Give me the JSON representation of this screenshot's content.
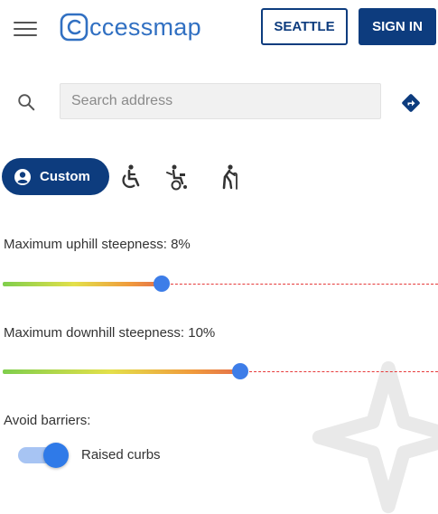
{
  "header": {
    "logo_text": "ccessmap",
    "logo_color": "#3170c2",
    "region_button": "SEATTLE",
    "signin_button": "SIGN IN",
    "brand_dark": "#0d3c7e"
  },
  "search": {
    "placeholder": "Search address",
    "value": ""
  },
  "profiles": {
    "items": [
      {
        "label": "Custom",
        "icon": "user-circle-icon",
        "selected": true
      },
      {
        "icon": "wheelchair-icon",
        "selected": false
      },
      {
        "icon": "powered-wheelchair-icon",
        "selected": false
      },
      {
        "icon": "cane-walker-icon",
        "selected": false
      }
    ]
  },
  "uphill": {
    "label": "Maximum uphill steepness: 8%",
    "value_fraction": 0.366
  },
  "downhill": {
    "label": "Maximum downhill steepness: 10%",
    "value_fraction": 0.545
  },
  "barriers": {
    "title": "Avoid barriers:",
    "raised_curbs_label": "Raised curbs",
    "raised_curbs_on": true
  }
}
